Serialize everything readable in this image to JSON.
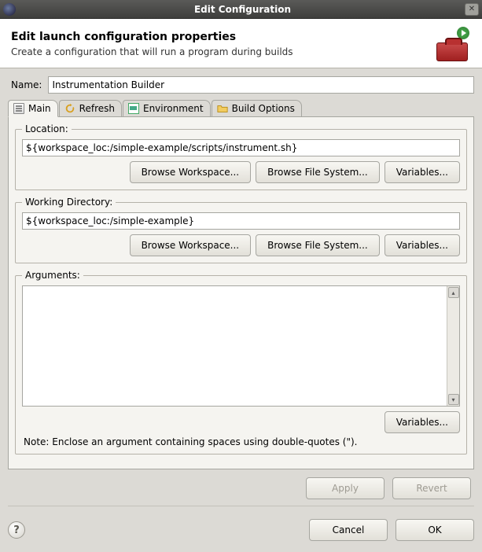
{
  "window": {
    "title": "Edit Configuration"
  },
  "header": {
    "heading": "Edit launch configuration properties",
    "sub": "Create a configuration that will run a program during builds"
  },
  "name": {
    "label": "Name:",
    "value": "Instrumentation Builder"
  },
  "tabs": [
    {
      "label": "Main"
    },
    {
      "label": "Refresh"
    },
    {
      "label": "Environment"
    },
    {
      "label": "Build Options"
    }
  ],
  "main": {
    "location": {
      "legend": "Location:",
      "value": "${workspace_loc:/simple-example/scripts/instrument.sh}",
      "browse_ws": "Browse Workspace...",
      "browse_fs": "Browse File System...",
      "variables": "Variables..."
    },
    "workdir": {
      "legend": "Working Directory:",
      "value": "${workspace_loc:/simple-example}",
      "browse_ws": "Browse Workspace...",
      "browse_fs": "Browse File System...",
      "variables": "Variables..."
    },
    "arguments": {
      "legend": "Arguments:",
      "value": "",
      "variables": "Variables...",
      "note": "Note: Enclose an argument containing spaces using double-quotes (\")."
    }
  },
  "apply": {
    "apply_label": "Apply",
    "revert_label": "Revert"
  },
  "footer": {
    "cancel": "Cancel",
    "ok": "OK"
  }
}
